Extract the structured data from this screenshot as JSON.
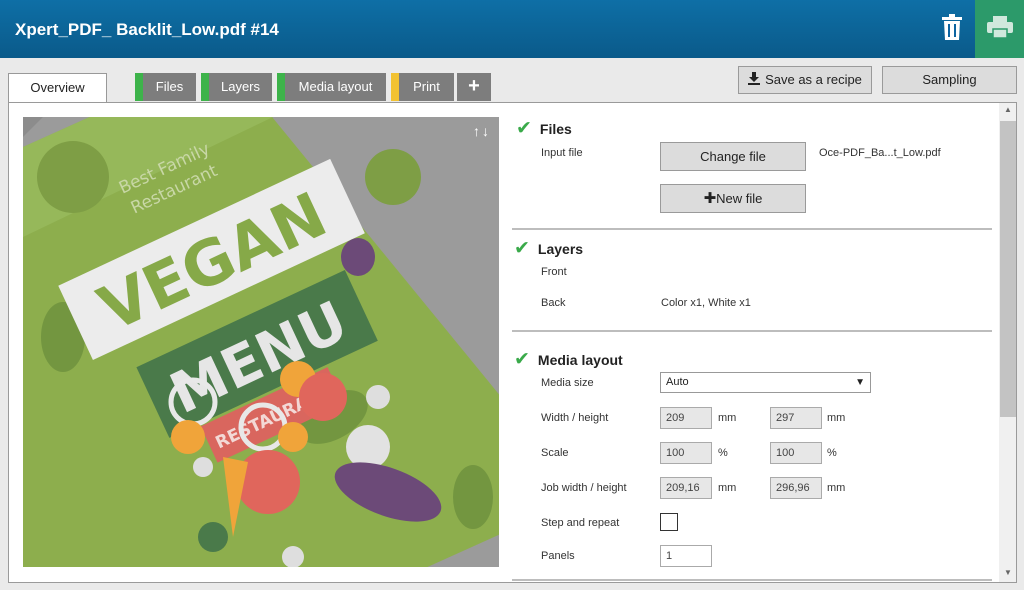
{
  "header": {
    "title": "Xpert_PDF_ Backlit_Low.pdf #14",
    "trash_icon": "trash-icon",
    "print_icon": "printer-icon"
  },
  "tabs": [
    {
      "label": "Overview"
    },
    {
      "label": "Files",
      "status_color": "#3db34a"
    },
    {
      "label": "Layers",
      "status_color": "#3db34a"
    },
    {
      "label": "Media layout",
      "status_color": "#3db34a"
    },
    {
      "label": "Print",
      "status_color": "#f2c232"
    },
    {
      "label": "+"
    }
  ],
  "actions": {
    "save_recipe": "Save as a recipe",
    "sampling": "Sampling"
  },
  "preview": {
    "arrows": "↑↓",
    "artwork": {
      "line1": "Best Family",
      "line2": "Restaurant",
      "vegan": "VEGAN",
      "menu": "MENU",
      "restaurant": "RESTAURANT"
    }
  },
  "files": {
    "title": "Files",
    "input_file_label": "Input file",
    "change_file": "Change file",
    "file_name": "Oce-PDF_Ba...t_Low.pdf",
    "new_file": "New file"
  },
  "layers": {
    "title": "Layers",
    "front_label": "Front",
    "back_label": "Back",
    "back_value": "Color x1, White x1"
  },
  "media_layout": {
    "title": "Media layout",
    "media_size_label": "Media size",
    "media_size_value": "Auto",
    "wh_label": "Width / height",
    "width": "209",
    "height": "297",
    "wh_unit": "mm",
    "scale_label": "Scale",
    "scale_x": "100",
    "scale_y": "100",
    "scale_unit": "%",
    "job_wh_label": "Job width / height",
    "job_width": "209,16",
    "job_height": "296,96",
    "job_unit": "mm",
    "step_repeat_label": "Step and repeat",
    "panels_label": "Panels",
    "panels_value": "1"
  },
  "colors": {
    "accent": "#0e6fa6",
    "ok": "#3aaa4a",
    "print_bg": "#2c9a6a"
  }
}
